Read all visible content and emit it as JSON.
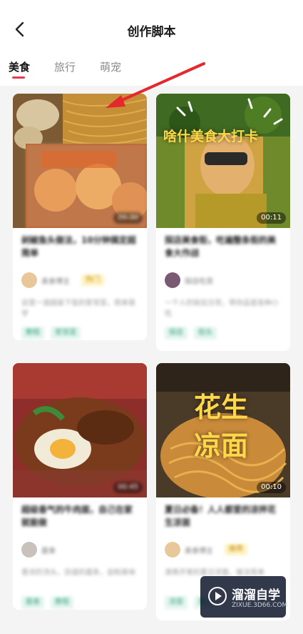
{
  "header": {
    "title": "创作脚本"
  },
  "tabs": [
    {
      "label": "美食",
      "active": true
    },
    {
      "label": "旅行",
      "active": false
    },
    {
      "label": "萌宠",
      "active": false
    }
  ],
  "cards": [
    {
      "title": "剁椒鱼头做法，10分钟搞定超简单",
      "author": "美食博主",
      "author_label": "热门",
      "desc": "这是一道超级下饭的家常菜，简单易学",
      "tags": [
        "教程",
        "家常菜"
      ],
      "duration": "00:30",
      "overlay": ""
    },
    {
      "title": "探店美食街，吃遍整条街的美食大作战",
      "author": "探店吃货",
      "author_label": "",
      "desc": "一个人的探店日常，带你品尝各种小吃",
      "tags": [
        "探店",
        "街头"
      ],
      "duration": "00:11",
      "overlay": "啥什美食大打卡"
    },
    {
      "title": "超级香气的牛肉面，自己在家就能做",
      "author": "面食",
      "author_label": "",
      "desc": "香浓的汤头，劲道的面条，自制美味",
      "tags": [
        "面食",
        "教程"
      ],
      "duration": "00:45",
      "overlay": ""
    },
    {
      "title": "夏日必备！人人都爱的凉拌花生凉面",
      "author": "美食博主",
      "author_label": "推荐",
      "desc": "清爽开胃的夏日凉面，做法简单",
      "tags": [
        "凉菜",
        "夏日"
      ],
      "duration": "00:10",
      "overlay": "花生凉面"
    }
  ],
  "watermark": {
    "name": "溜溜自学",
    "url": "ZIXUE.3D66.COM"
  }
}
